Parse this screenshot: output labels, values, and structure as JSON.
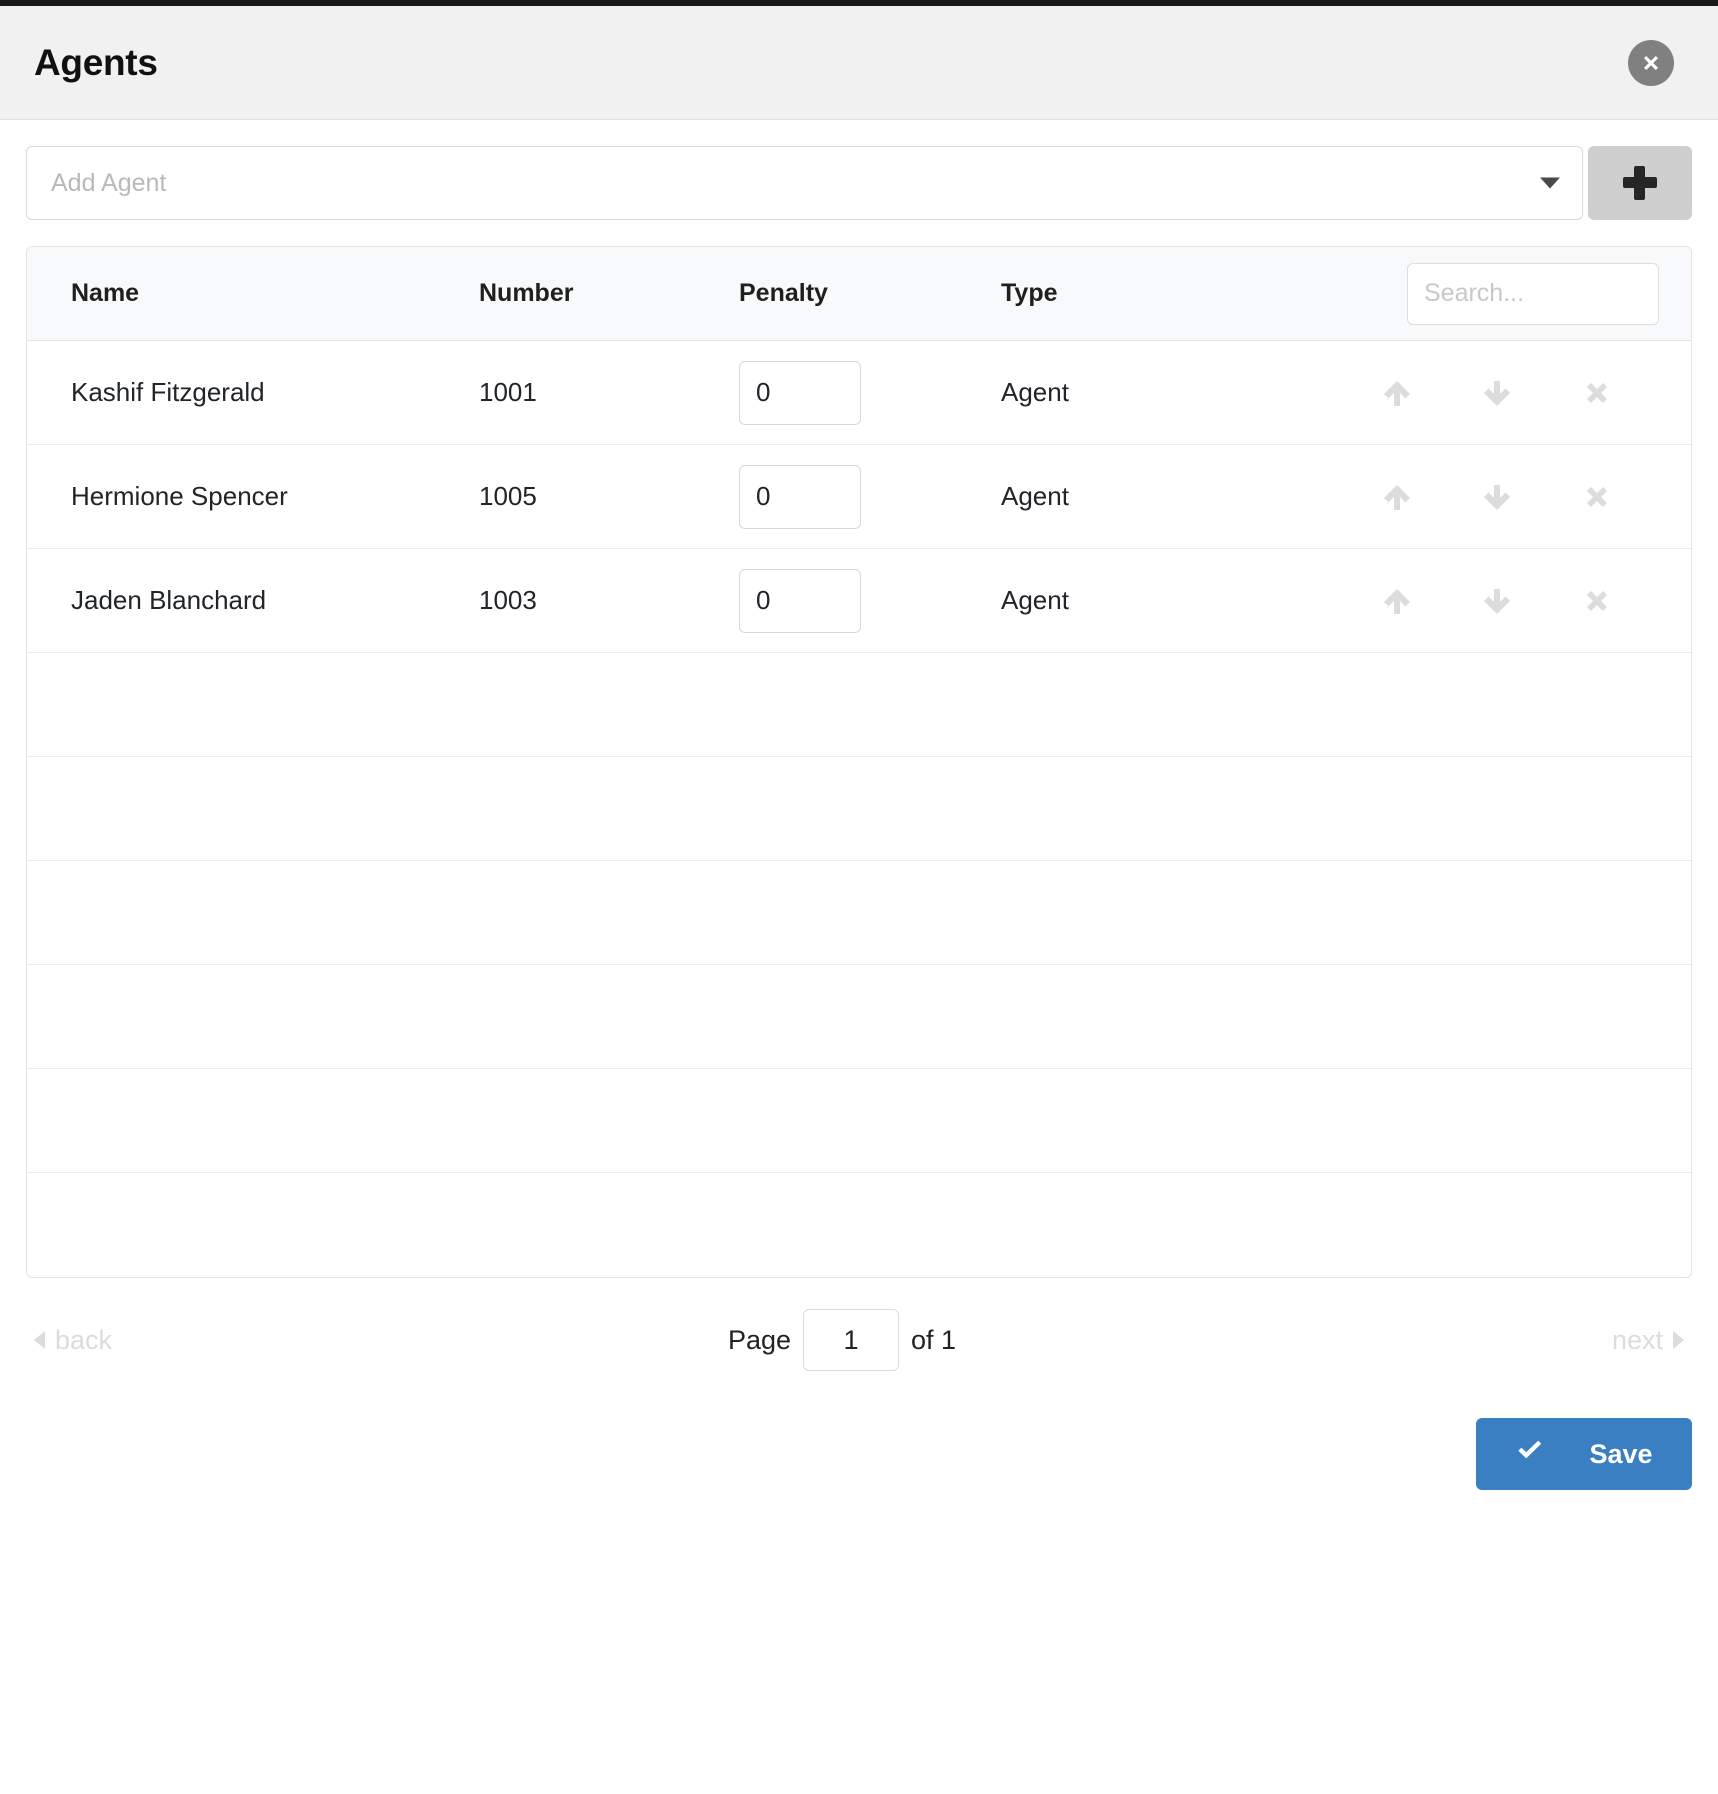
{
  "header": {
    "title": "Agents",
    "close_icon": "close-circle-icon"
  },
  "add_agent": {
    "placeholder": "Add Agent",
    "value": "",
    "caret_icon": "chevron-down-icon",
    "add_button_icon": "plus-icon"
  },
  "table": {
    "columns": [
      "Name",
      "Number",
      "Penalty",
      "Type"
    ],
    "search": {
      "placeholder": "Search...",
      "value": ""
    },
    "rows": [
      {
        "name": "Kashif Fitzgerald",
        "number": "1001",
        "penalty": "0",
        "type": "Agent"
      },
      {
        "name": "Hermione Spencer",
        "number": "1005",
        "penalty": "0",
        "type": "Agent"
      },
      {
        "name": "Jaden Blanchard",
        "number": "1003",
        "penalty": "0",
        "type": "Agent"
      }
    ],
    "empty_row_count": 6,
    "row_action_icons": [
      "arrow-up-icon",
      "arrow-down-icon",
      "remove-x-icon"
    ]
  },
  "pagination": {
    "back_label": "back",
    "next_label": "next",
    "page_label": "Page",
    "page_value": "1",
    "of_label": "of 1"
  },
  "footer": {
    "save_label": "Save",
    "save_icon": "check-icon"
  },
  "colors": {
    "header_bg": "#f1f1f1",
    "accent_blue": "#3a7fc1",
    "muted_gray": "#dcdcdc",
    "add_button_gray": "#cfcfcf"
  }
}
